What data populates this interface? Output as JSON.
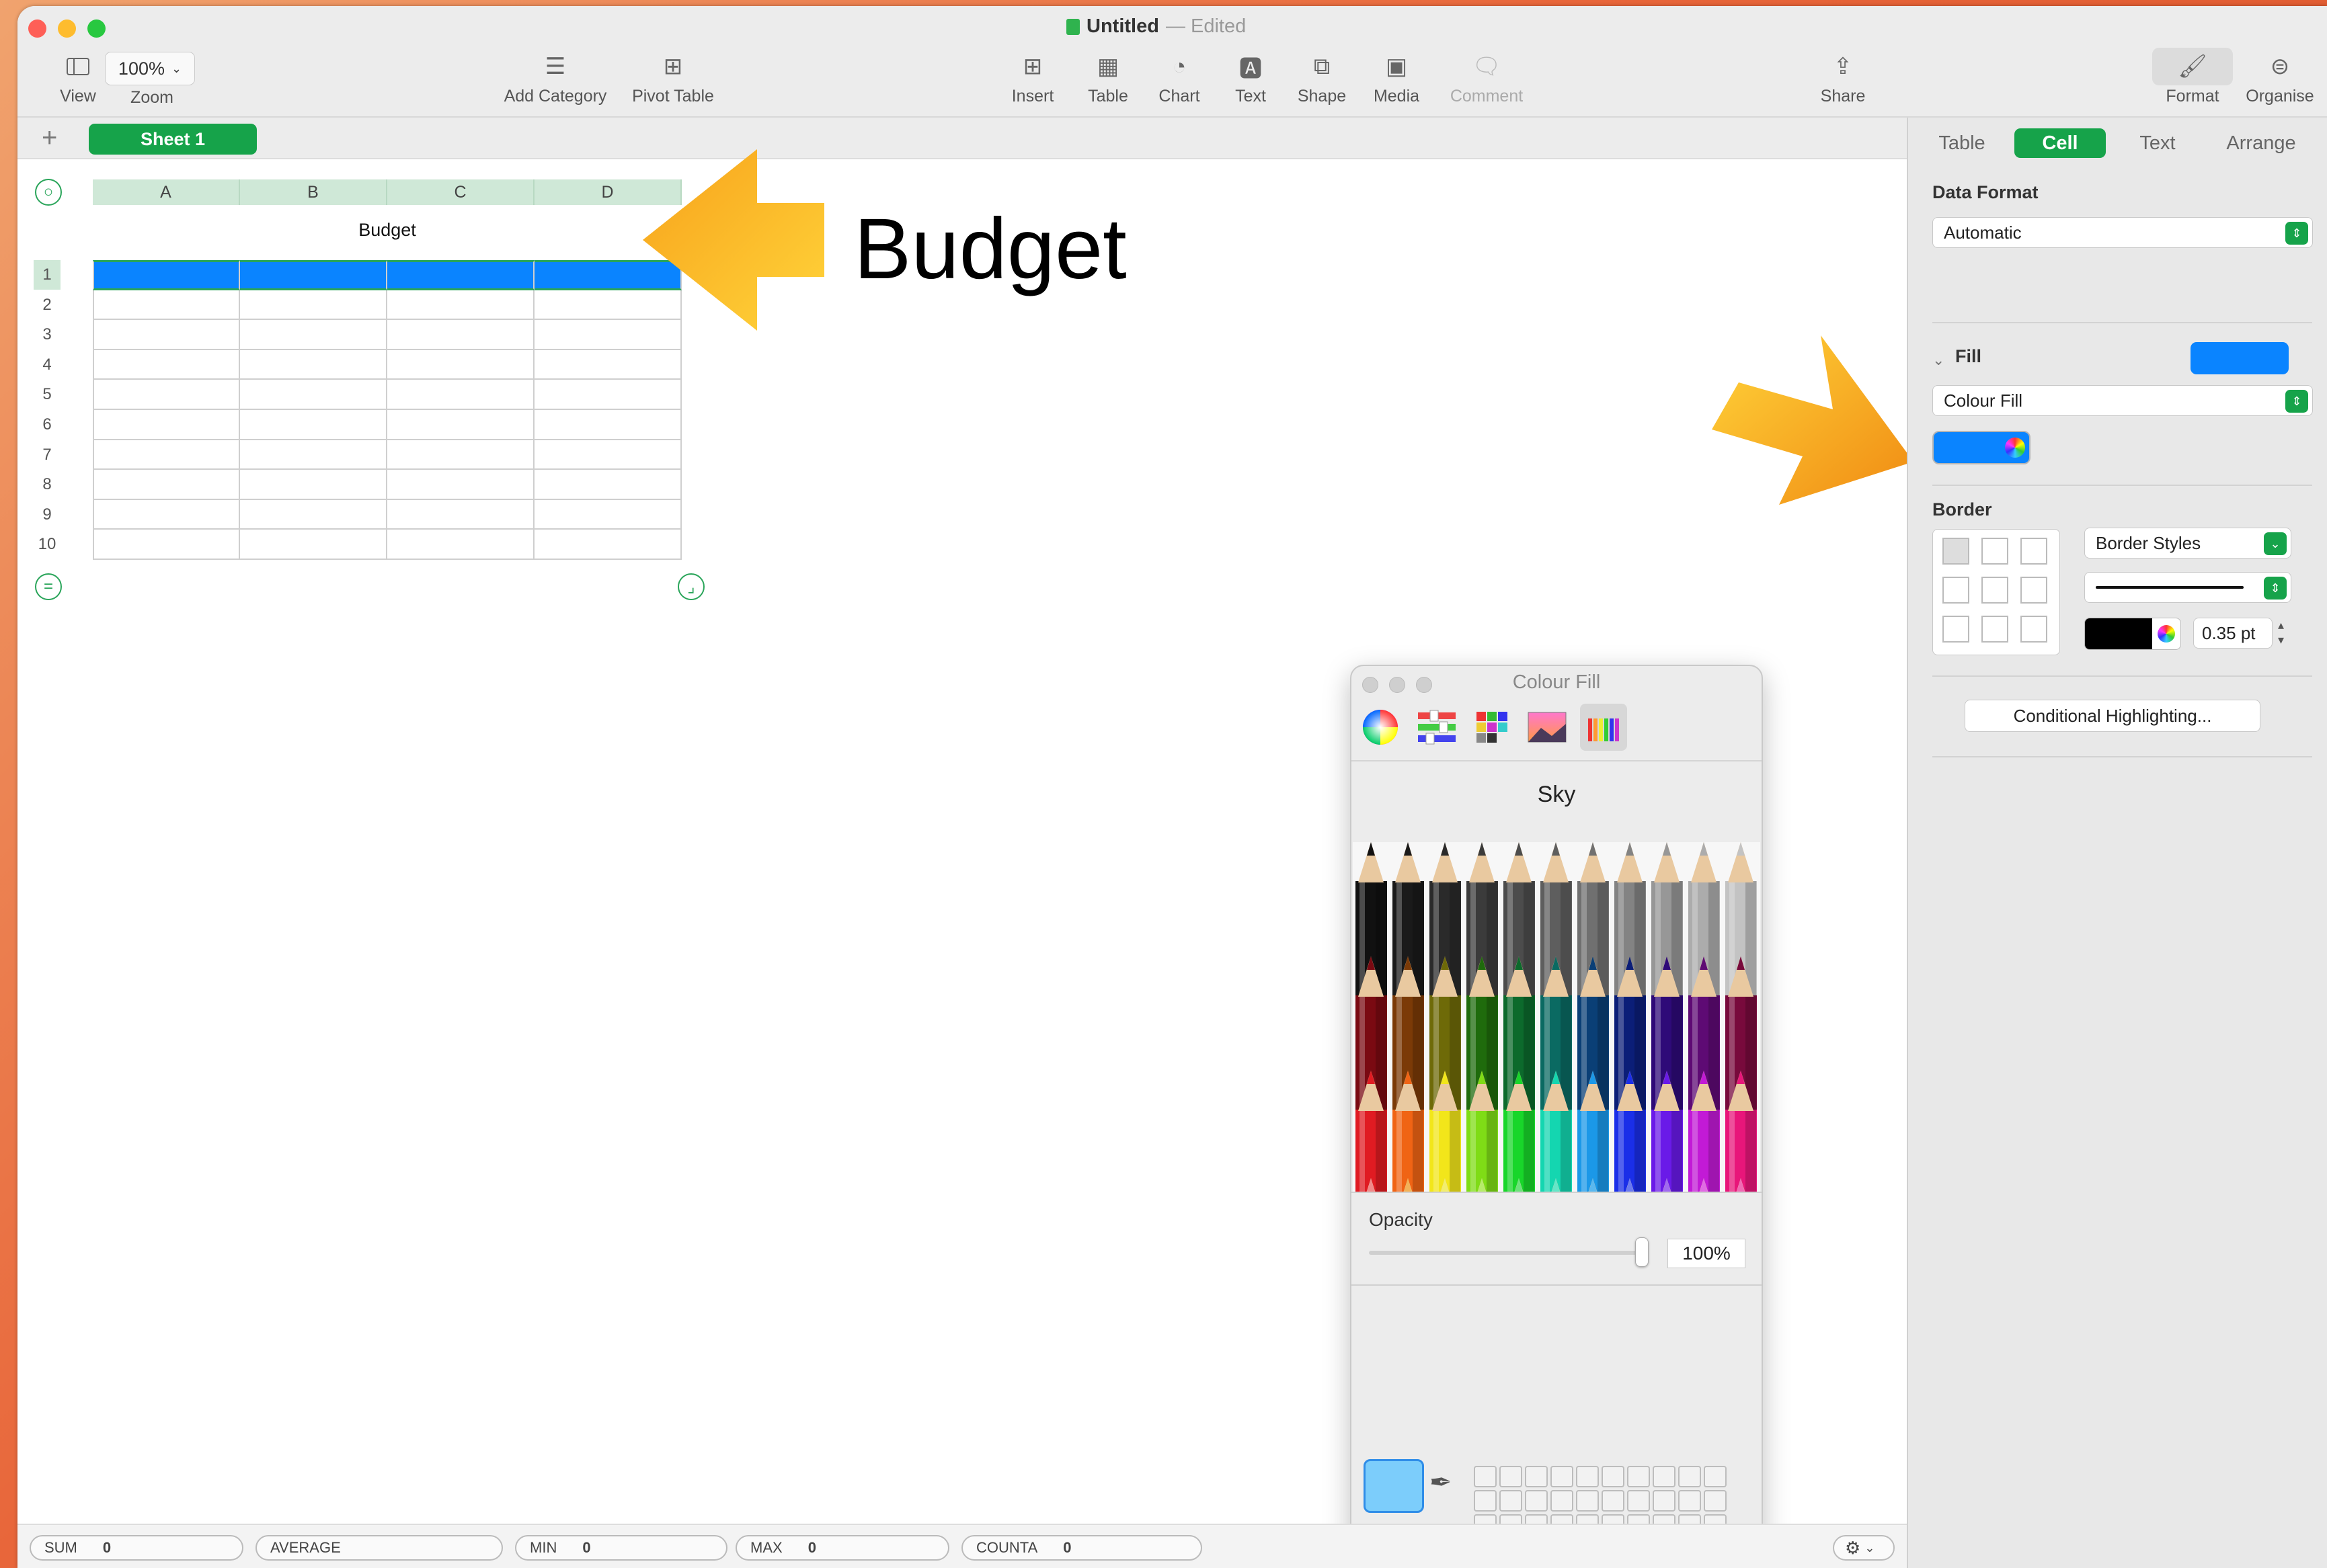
{
  "window": {
    "title": "Untitled",
    "status": "— Edited"
  },
  "toolbar": {
    "view": "View",
    "zoom_value": "100%",
    "zoom": "Zoom",
    "add_category": "Add Category",
    "pivot_table": "Pivot Table",
    "insert": "Insert",
    "table": "Table",
    "chart": "Chart",
    "text": "Text",
    "shape": "Shape",
    "media": "Media",
    "comment": "Comment",
    "share": "Share",
    "format": "Format",
    "organise": "Organise"
  },
  "sheet": {
    "tab": "Sheet 1",
    "columns": [
      "A",
      "B",
      "C",
      "D"
    ],
    "rows": [
      "1",
      "2",
      "3",
      "4",
      "5",
      "6",
      "7",
      "8",
      "9",
      "10"
    ],
    "table_title": "Budget",
    "fill_color": "#0a84ff",
    "big_title": "Budget"
  },
  "status_bar": [
    {
      "label": "SUM",
      "value": "0"
    },
    {
      "label": "AVERAGE",
      "value": ""
    },
    {
      "label": "MIN",
      "value": "0"
    },
    {
      "label": "MAX",
      "value": "0"
    },
    {
      "label": "COUNTA",
      "value": "0"
    }
  ],
  "inspector": {
    "tabs": [
      "Table",
      "Cell",
      "Text",
      "Arrange"
    ],
    "selected_tab": "Cell",
    "data_format_label": "Data Format",
    "data_format_value": "Automatic",
    "fill_label": "Fill",
    "fill_type": "Colour Fill",
    "fill_color": "#0a84ff",
    "border_label": "Border",
    "border_styles": "Border Styles",
    "border_color": "#000000",
    "border_width": "0.35 pt",
    "conditional_button": "Conditional Highlighting..."
  },
  "colour_panel": {
    "title": "Colour Fill",
    "palette_name": "Sky",
    "opacity_label": "Opacity",
    "opacity_value": "100%",
    "opacity": 1.0,
    "selected_color": "#7ccdfb",
    "pencil_rows": [
      [
        "#111111",
        "#1a1a1a",
        "#2a2a2a",
        "#3b3b3b",
        "#4c4c4c",
        "#5e5e5e",
        "#707070",
        "#838383",
        "#979797",
        "#acacac",
        "#c3c3c3"
      ],
      [
        "#7a0a12",
        "#7b3a07",
        "#6e6a08",
        "#1f6b0c",
        "#0c6a2c",
        "#0a6a62",
        "#0a3f76",
        "#0b1e78",
        "#2e0a78",
        "#5e0a74",
        "#780a3c"
      ],
      [
        "#e01b22",
        "#f06414",
        "#f2e61a",
        "#7fdc16",
        "#18d62a",
        "#14d6b0",
        "#1b98e8",
        "#1a2ee8",
        "#6a1ae8",
        "#c21ad6",
        "#e8167a"
      ],
      [
        "#f08a8a",
        "#f2b258",
        "#f2ee6e",
        "#b6ec6a",
        "#6be27a",
        "#64e6c8",
        "#5ab8ef",
        "#6a7af0",
        "#a06af0",
        "#e06ae4",
        "#f06ab4"
      ]
    ]
  }
}
